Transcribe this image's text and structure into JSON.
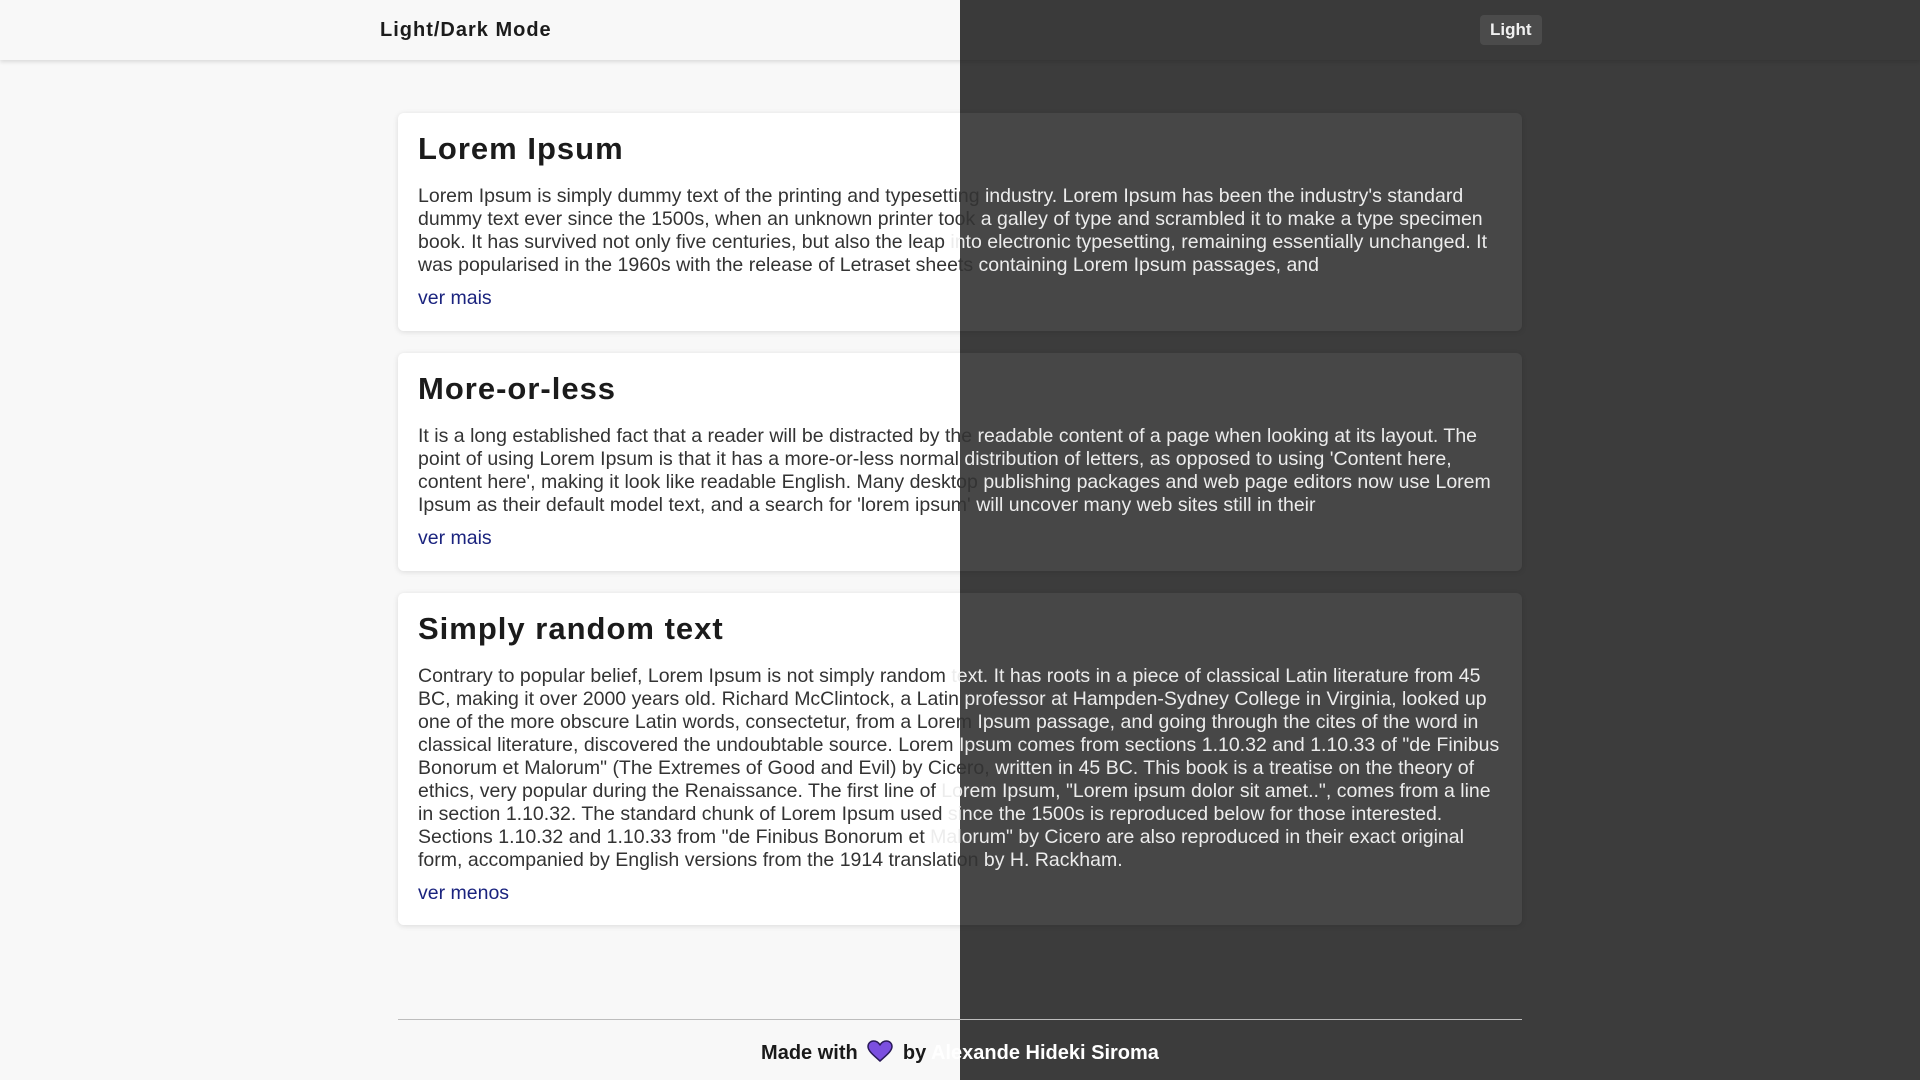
{
  "header": {
    "title": "Light/Dark Mode",
    "mode_toggle_label": "Light"
  },
  "cards": [
    {
      "title": "Lorem Ipsum",
      "text": "Lorem Ipsum is simply dummy text of the printing and typesetting industry. Lorem Ipsum has been the industry's standard dummy text ever since the 1500s, when an unknown printer took a galley of type and scrambled it to make a type specimen book. It has survived not only five centuries, but also the leap into electronic typesetting, remaining essentially unchanged. It was popularised in the 1960s with the release of Letraset sheets containing Lorem Ipsum passages, and",
      "link": "ver mais"
    },
    {
      "title": "More-or-less",
      "text": "It is a long established fact that a reader will be distracted by the readable content of a page when looking at its layout. The point of using Lorem Ipsum is that it has a more-or-less normal distribution of letters, as opposed to using 'Content here, content here', making it look like readable English. Many desktop publishing packages and web page editors now use Lorem Ipsum as their default model text, and a search for 'lorem ipsum' will uncover many web sites still in their",
      "link": "ver mais"
    },
    {
      "title": "Simply random text",
      "text": "Contrary to popular belief, Lorem Ipsum is not simply random text. It has roots in a piece of classical Latin literature from 45 BC, making it over 2000 years old. Richard McClintock, a Latin professor at Hampden-Sydney College in Virginia, looked up one of the more obscure Latin words, consectetur, from a Lorem Ipsum passage, and going through the cites of the word in classical literature, discovered the undoubtable source. Lorem Ipsum comes from sections 1.10.32 and 1.10.33 of \"de Finibus Bonorum et Malorum\" (The Extremes of Good and Evil) by Cicero, written in 45 BC. This book is a treatise on the theory of ethics, very popular during the Renaissance. The first line of Lorem Ipsum, \"Lorem ipsum dolor sit amet..\", comes from a line in section 1.10.32. The standard chunk of Lorem Ipsum used since the 1500s is reproduced below for those interested. Sections 1.10.32 and 1.10.33 from \"de Finibus Bonorum et Malorum\" by Cicero are also reproduced in their exact original form, accompanied by English versions from the 1914 translation by H. Rackham.",
      "link": "ver menos"
    }
  ],
  "footer": {
    "prefix": "Made with",
    "heart_icon": "heart-icon",
    "suffix": "by Alexande Hideki Siroma"
  },
  "colors": {
    "light_background": "#f8f8f8",
    "dark_background": "#3c3c3c",
    "link": "#1a237e",
    "heart": "#7b4fe0"
  }
}
